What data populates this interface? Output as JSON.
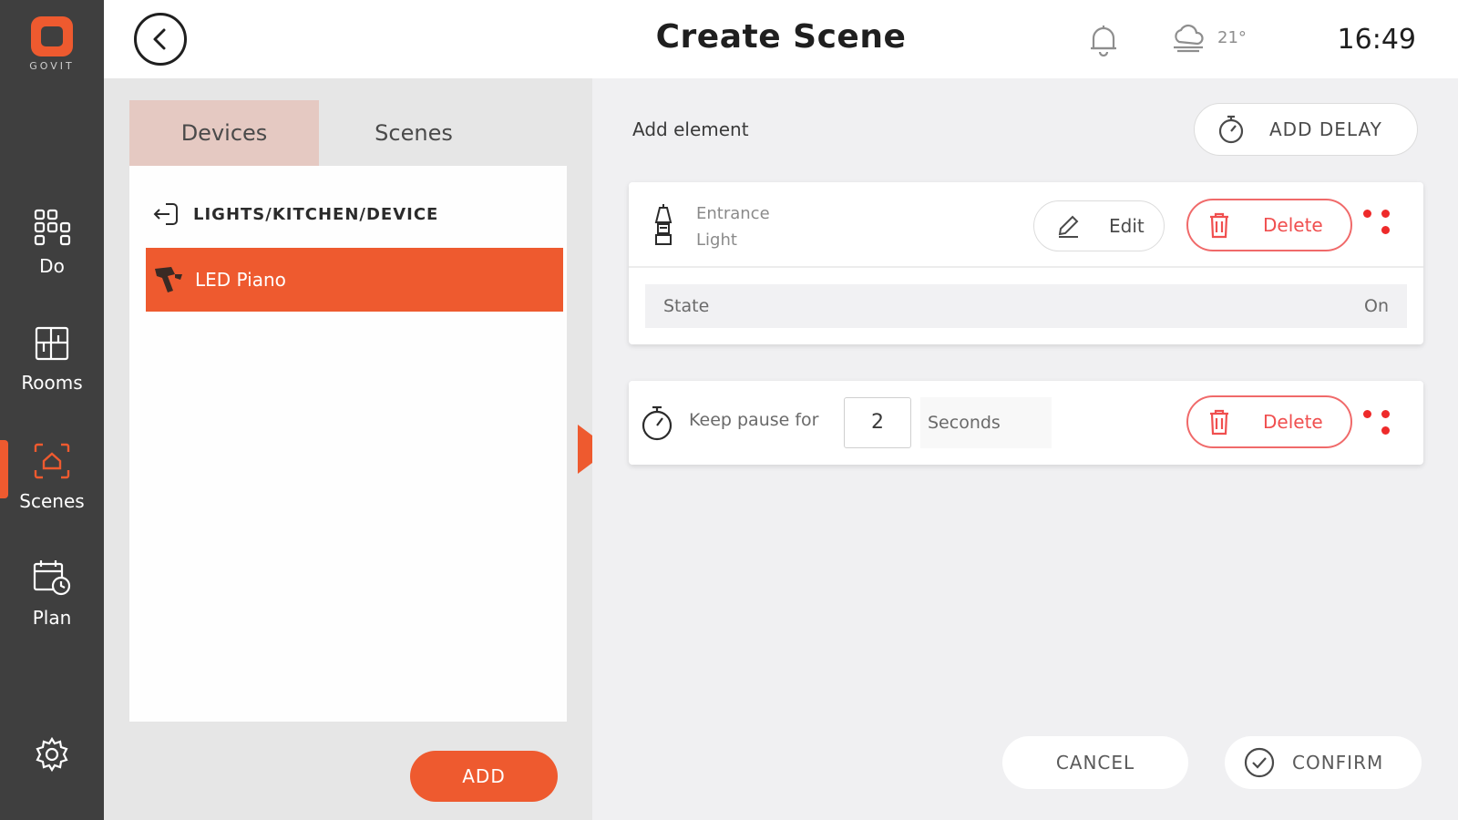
{
  "app": {
    "brand": "GOVIT",
    "accent_color": "#ee5a2f"
  },
  "sidebar": {
    "items": [
      {
        "label": "Do",
        "icon": "grid-icon"
      },
      {
        "label": "Rooms",
        "icon": "rooms-icon"
      },
      {
        "label": "Scenes",
        "icon": "scenes-icon",
        "active": true
      },
      {
        "label": "Plan",
        "icon": "calendar-clock-icon"
      }
    ],
    "settings_icon": "gear-icon"
  },
  "header": {
    "title": "Create Scene",
    "temperature": "21°",
    "time": "16:49"
  },
  "left_panel": {
    "tabs": [
      {
        "label": "Devices",
        "active": true
      },
      {
        "label": "Scenes",
        "active": false
      }
    ],
    "breadcrumb": "LIGHTS/KITCHEN/DEVICE",
    "devices": [
      {
        "label": "LED Piano",
        "selected": true
      }
    ],
    "add_label": "ADD"
  },
  "right_panel": {
    "add_element_label": "Add element",
    "add_delay_label": "ADD DELAY",
    "elements": [
      {
        "type": "device",
        "name_line1": "Entrance",
        "name_line2": "Light",
        "edit_label": "Edit",
        "delete_label": "Delete",
        "state_label": "State",
        "state_value": "On"
      },
      {
        "type": "delay",
        "prefix": "Keep pause for",
        "value": "2",
        "unit": "Seconds",
        "delete_label": "Delete"
      }
    ],
    "cancel_label": "CANCEL",
    "confirm_label": "CONFIRM"
  }
}
